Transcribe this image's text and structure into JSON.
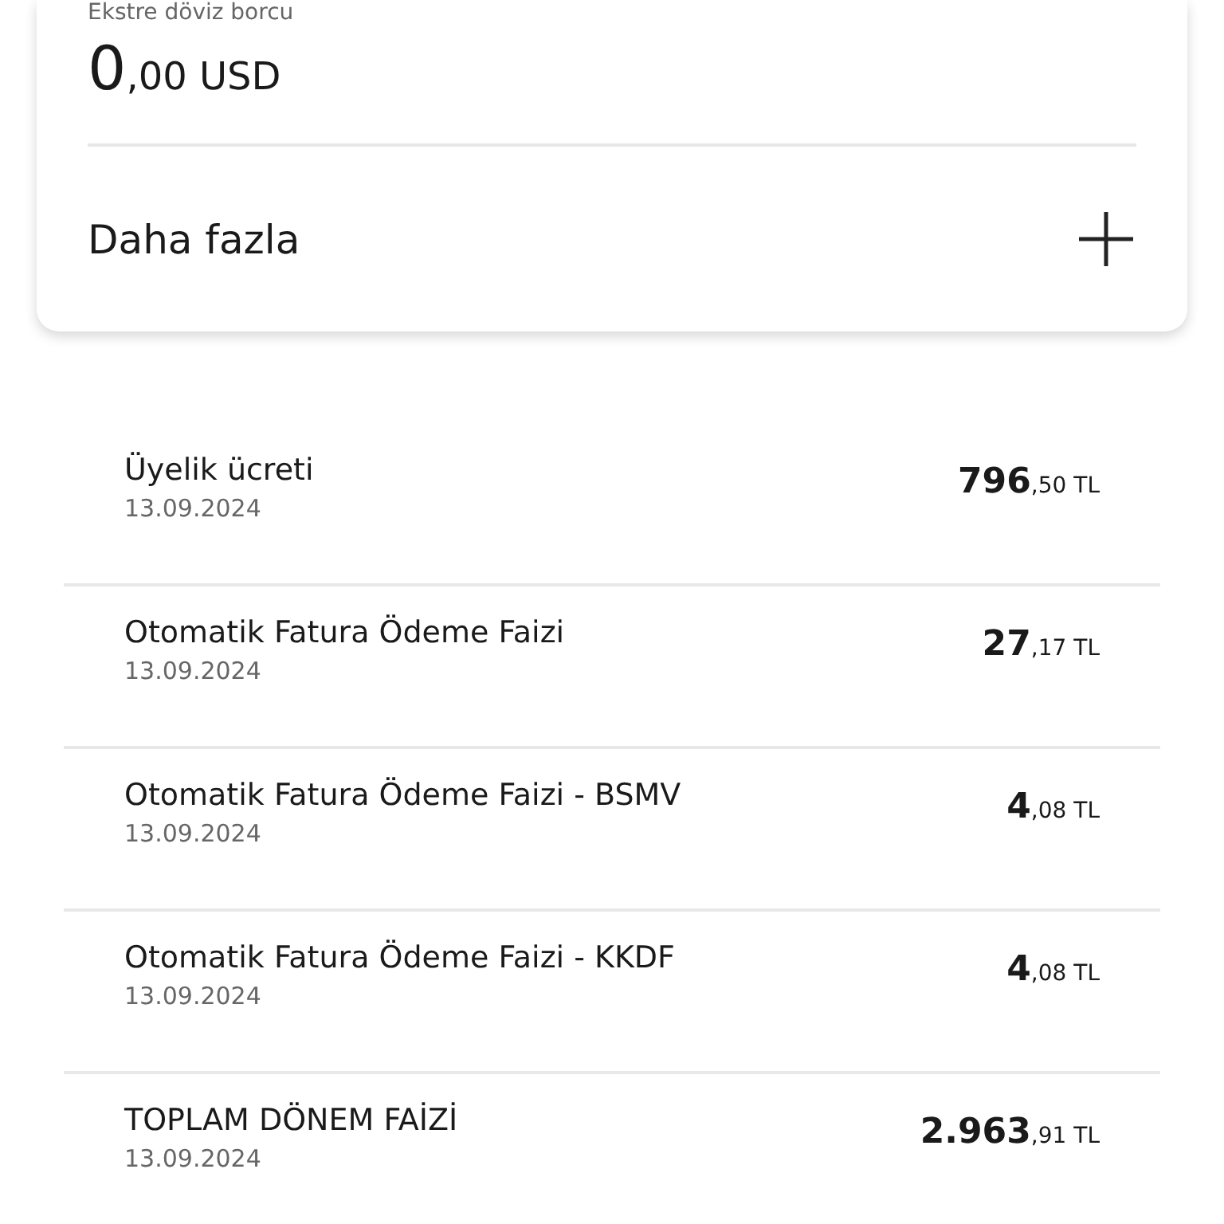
{
  "card": {
    "label": "Ekstre döviz borcu",
    "amount_main": "0",
    "amount_rest": ",00 USD",
    "more": "Daha fazla"
  },
  "transactions": [
    {
      "title": "Üyelik ücreti",
      "date": "13.09.2024",
      "amount_main": "796",
      "amount_rest": ",50 TL"
    },
    {
      "title": "Otomatik Fatura Ödeme Faizi",
      "date": "13.09.2024",
      "amount_main": "27",
      "amount_rest": ",17 TL"
    },
    {
      "title": "Otomatik Fatura Ödeme Faizi - BSMV",
      "date": "13.09.2024",
      "amount_main": "4",
      "amount_rest": ",08 TL"
    },
    {
      "title": "Otomatik Fatura Ödeme Faizi - KKDF",
      "date": "13.09.2024",
      "amount_main": "4",
      "amount_rest": ",08 TL"
    },
    {
      "title": "TOPLAM DÖNEM FAİZİ",
      "date": "13.09.2024",
      "amount_main": "2.963",
      "amount_rest": ",91 TL"
    }
  ]
}
